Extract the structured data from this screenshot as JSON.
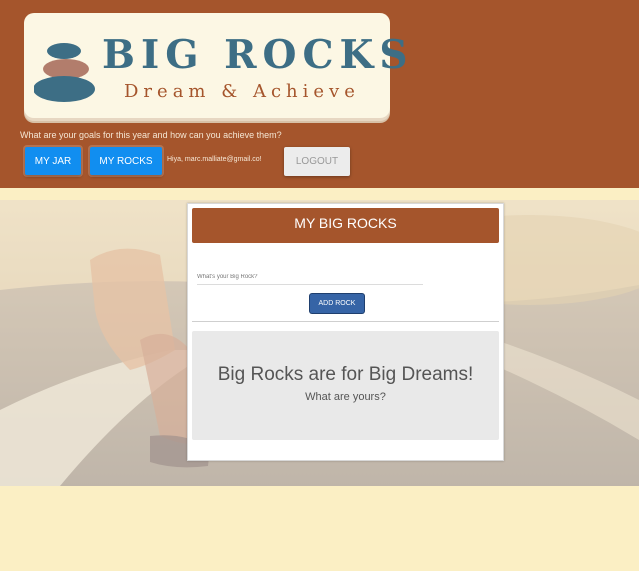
{
  "colors": {
    "brand_rust": "#a5552c",
    "logo_slate": "#3d6e85",
    "cream_background": "#fbefc4",
    "button_blue": "#118ef0",
    "add_button_navy": "#3664a6",
    "logout_grey": "#ececec"
  },
  "logo": {
    "title": "BIG ROCKS",
    "tagline": "Dream & Achieve",
    "icon": "stacked-stones-icon"
  },
  "header": {
    "question": "What are your goals for this year and how can you achieve them?",
    "nav": {
      "jar_label": "MY JAR",
      "rocks_label": "MY ROCKS"
    },
    "greeting": "Hiya, marc.malliate@gmail.co!",
    "logout_label": "LOGOUT"
  },
  "panel": {
    "title": "MY BIG ROCKS",
    "input_placeholder": "What's your Big Rock?",
    "input_value": "",
    "add_label": "ADD ROCK",
    "empty_title": "Big Rocks are for Big Dreams!",
    "empty_subtitle": "What are yours?"
  }
}
